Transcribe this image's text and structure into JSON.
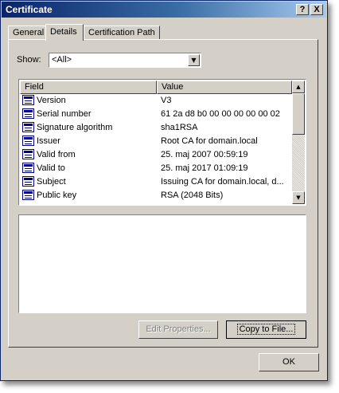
{
  "window": {
    "title": "Certificate",
    "help_label": "?",
    "close_label": "X"
  },
  "tabs": [
    "General",
    "Details",
    "Certification Path"
  ],
  "show": {
    "label": "Show:",
    "value": "<All>"
  },
  "table": {
    "columns": [
      "Field",
      "Value"
    ],
    "rows": [
      {
        "field": "Version",
        "value": "V3"
      },
      {
        "field": "Serial number",
        "value": "61 2a d8 b0 00 00 00 00 00 02"
      },
      {
        "field": "Signature algorithm",
        "value": "sha1RSA"
      },
      {
        "field": "Issuer",
        "value": "Root CA for domain.local"
      },
      {
        "field": "Valid from",
        "value": "25. maj 2007 00:59:19"
      },
      {
        "field": "Valid to",
        "value": "25. maj 2017 01:09:19"
      },
      {
        "field": "Subject",
        "value": "Issuing CA for domain.local, d..."
      },
      {
        "field": "Public key",
        "value": "RSA (2048 Bits)"
      }
    ]
  },
  "buttons": {
    "edit_properties": "Edit Properties...",
    "copy_to_file": "Copy to File...",
    "ok": "OK"
  }
}
